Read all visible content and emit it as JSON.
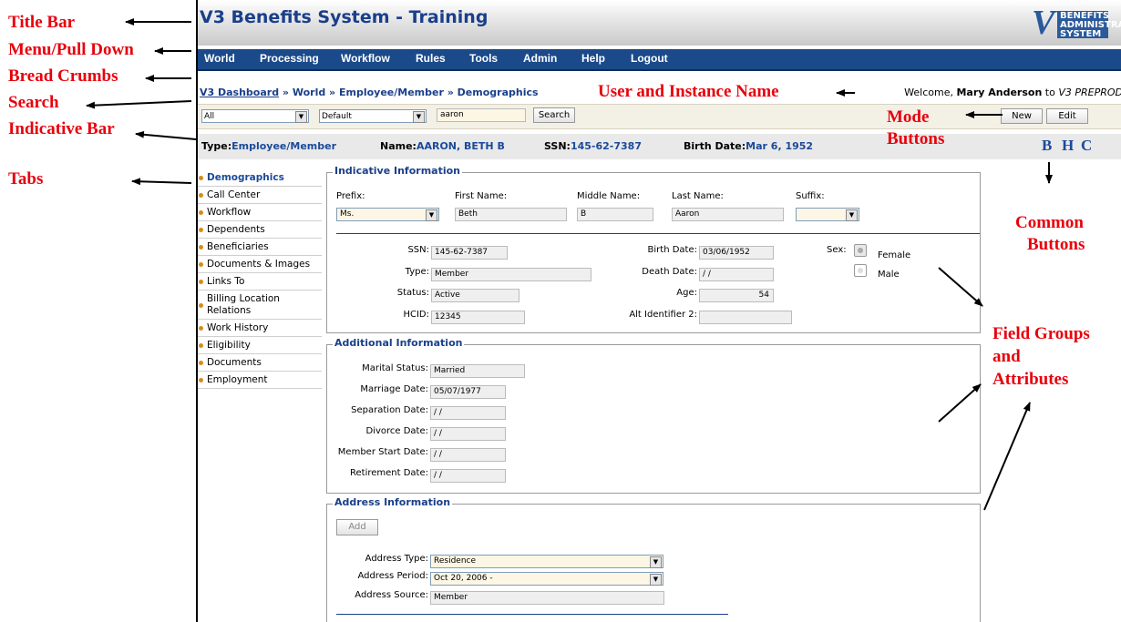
{
  "annotations": {
    "title_bar": "Title Bar",
    "menu": "Menu/Pull Down",
    "bread_crumbs": "Bread Crumbs",
    "search": "Search",
    "indicative_bar": "Indicative Bar",
    "tabs": "Tabs",
    "user_instance": "User and Instance Name",
    "mode_buttons_1": "Mode",
    "mode_buttons_2": "Buttons",
    "common_buttons_1": "Common",
    "common_buttons_2": "Buttons",
    "field_groups_1": "Field Groups",
    "field_groups_2": "and",
    "field_groups_3": "Attributes"
  },
  "app": {
    "title": "V3 Benefits System - Training",
    "logo_text": "BENEFITS ADMINISTRATION SYSTEM",
    "menu": [
      "World",
      "Processing",
      "Workflow",
      "Rules",
      "Tools",
      "Admin",
      "Help",
      "Logout"
    ],
    "breadcrumb": {
      "link": "V3 Dashboard",
      "rest": " » World » Employee/Member » Demographics"
    },
    "welcome": {
      "prefix": "Welcome, ",
      "user": "Mary Anderson",
      "mid": " to ",
      "instance": "V3 PREPROD"
    },
    "search": {
      "scope": "All",
      "view": "Default",
      "query": "aaron",
      "button": "Search"
    },
    "mode_buttons": {
      "new": "New",
      "edit": "Edit"
    },
    "indicative": {
      "type_label": "Type:",
      "type_value": "Employee/Member",
      "name_label": "Name:",
      "name_value": "AARON, BETH B",
      "ssn_label": "SSN:",
      "ssn_value": "145-62-7387",
      "birth_label": "Birth Date:",
      "birth_value": "Mar 6, 1952"
    },
    "common_buttons": {
      "b": "B",
      "h": "H",
      "c": "C"
    },
    "tabs": [
      "Demographics",
      "Call Center",
      "Workflow",
      "Dependents",
      "Beneficiaries",
      "Documents & Images",
      "Links To",
      "Billing Location Relations",
      "Work History",
      "Eligibility",
      "Documents",
      "Employment"
    ],
    "indicative_info": {
      "legend": "Indicative Information",
      "prefix_label": "Prefix:",
      "prefix_value": "Ms.",
      "first_label": "First Name:",
      "first_value": "Beth",
      "middle_label": "Middle Name:",
      "middle_value": "B",
      "last_label": "Last Name:",
      "last_value": "Aaron",
      "suffix_label": "Suffix:",
      "suffix_value": "",
      "ssn_label": "SSN:",
      "ssn_value": "145-62-7387",
      "type_label": "Type:",
      "type_value": "Member",
      "status_label": "Status:",
      "status_value": "Active",
      "hcid_label": "HCID:",
      "hcid_value": "12345",
      "birth_label": "Birth Date:",
      "birth_value": "03/06/1952",
      "death_label": "Death Date:",
      "death_value": " / /",
      "age_label": "Age:",
      "age_value": "54",
      "alt_label": "Alt Identifier 2:",
      "alt_value": "",
      "sex_label": "Sex:",
      "female": "Female",
      "male": "Male"
    },
    "additional_info": {
      "legend": "Additional Information",
      "marital_label": "Marital Status:",
      "marital_value": "Married",
      "marriage_label": "Marriage Date:",
      "marriage_value": "05/07/1977",
      "separation_label": "Separation Date:",
      "separation_value": " / /",
      "divorce_label": "Divorce Date:",
      "divorce_value": " / /",
      "member_start_label": "Member Start Date:",
      "member_start_value": " / /",
      "retirement_label": "Retirement Date:",
      "retirement_value": " / /"
    },
    "address_info": {
      "legend": "Address Information",
      "add_button": "Add",
      "type_label": "Address Type:",
      "type_value": "Residence",
      "period_label": "Address Period:",
      "period_value": "Oct 20, 2006 -",
      "source_label": "Address Source:",
      "source_value": "Member"
    }
  }
}
